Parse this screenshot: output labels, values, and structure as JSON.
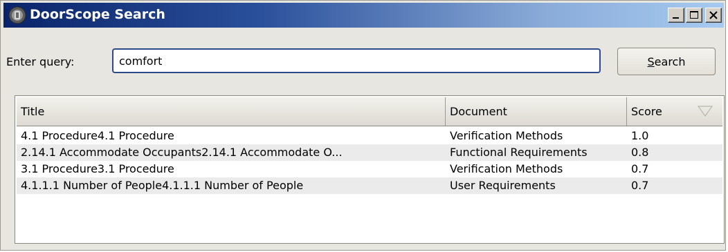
{
  "window": {
    "title": "DoorScope Search",
    "icon": "app-icon",
    "controls": [
      "minimize-icon",
      "maximize-icon",
      "close-icon"
    ]
  },
  "query": {
    "label": "Enter query:",
    "value": "comfort"
  },
  "search_button": {
    "mnemonic": "S",
    "rest": "earch"
  },
  "results": {
    "columns": [
      "Title",
      "Document",
      "Score"
    ],
    "sort_icon": "sort-descending-icon",
    "rows": [
      {
        "title": "4.1 Procedure4.1 Procedure",
        "document": "Verification Methods",
        "score": "1.0"
      },
      {
        "title": "2.14.1 Accommodate Occupants2.14.1 Accommodate O...",
        "document": "Functional Requirements",
        "score": "0.8"
      },
      {
        "title": "3.1 Procedure3.1 Procedure",
        "document": "Verification Methods",
        "score": "0.7"
      },
      {
        "title": "4.1.1.1 Number of People4.1.1.1 Number of People",
        "document": "User Requirements",
        "score": "0.7"
      }
    ]
  }
}
